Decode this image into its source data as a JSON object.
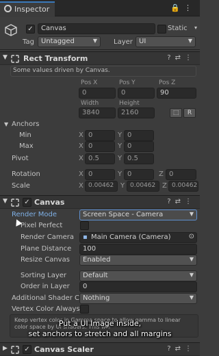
{
  "tab": {
    "title": "Inspector"
  },
  "object": {
    "active": true,
    "name": "Canvas",
    "static_label": "Static",
    "tag_label": "Tag",
    "tag_value": "Untagged",
    "layer_label": "Layer",
    "layer_value": "UI"
  },
  "rect": {
    "title": "Rect Transform",
    "info": "Some values driven by Canvas.",
    "pos_x_label": "Pos X",
    "pos_y_label": "Pos Y",
    "pos_z_label": "Pos Z",
    "pos_x": "0",
    "pos_y": "0",
    "pos_z": "90",
    "width_label": "Width",
    "height_label": "Height",
    "width": "3840",
    "height": "2160",
    "r_button": "R",
    "anchors_label": "Anchors",
    "min_label": "Min",
    "min_x": "0",
    "min_y": "0",
    "max_label": "Max",
    "max_x": "0",
    "max_y": "0",
    "pivot_label": "Pivot",
    "pivot_x": "0.5",
    "pivot_y": "0.5",
    "rotation_label": "Rotation",
    "rot_x": "0",
    "rot_y": "0",
    "rot_z": "0",
    "scale_label": "Scale",
    "scale_x": "0.00462",
    "scale_y": "0.00462",
    "scale_z": "0.00462",
    "x": "X",
    "y": "Y",
    "z": "Z"
  },
  "canvas": {
    "title": "Canvas",
    "enabled": true,
    "render_mode_label": "Render Mode",
    "render_mode": "Screen Space - Camera",
    "pixel_perfect_label": "Pixel Perfect",
    "render_camera_label": "Render Camera",
    "render_camera": "Main Camera (Camera)",
    "plane_distance_label": "Plane Distance",
    "plane_distance": "100",
    "resize_canvas_label": "Resize Canvas",
    "resize_canvas": "Enabled",
    "sorting_layer_label": "Sorting Layer",
    "sorting_layer": "Default",
    "order_label": "Order in Layer",
    "order": "0",
    "shader_label": "Additional Shader Cha",
    "shader": "Nothing",
    "vertex_label": "Vertex Color Always I",
    "help_line1": "Keep vertex color in Gamma space to allow gamma to linear",
    "help_line2": "color space             by UI shaders. This will"
  },
  "scaler": {
    "title": "Canvas Scaler"
  },
  "caption": {
    "line1": "Put a UI Image inside,",
    "line2": "set anchors to stretch and all margins"
  }
}
